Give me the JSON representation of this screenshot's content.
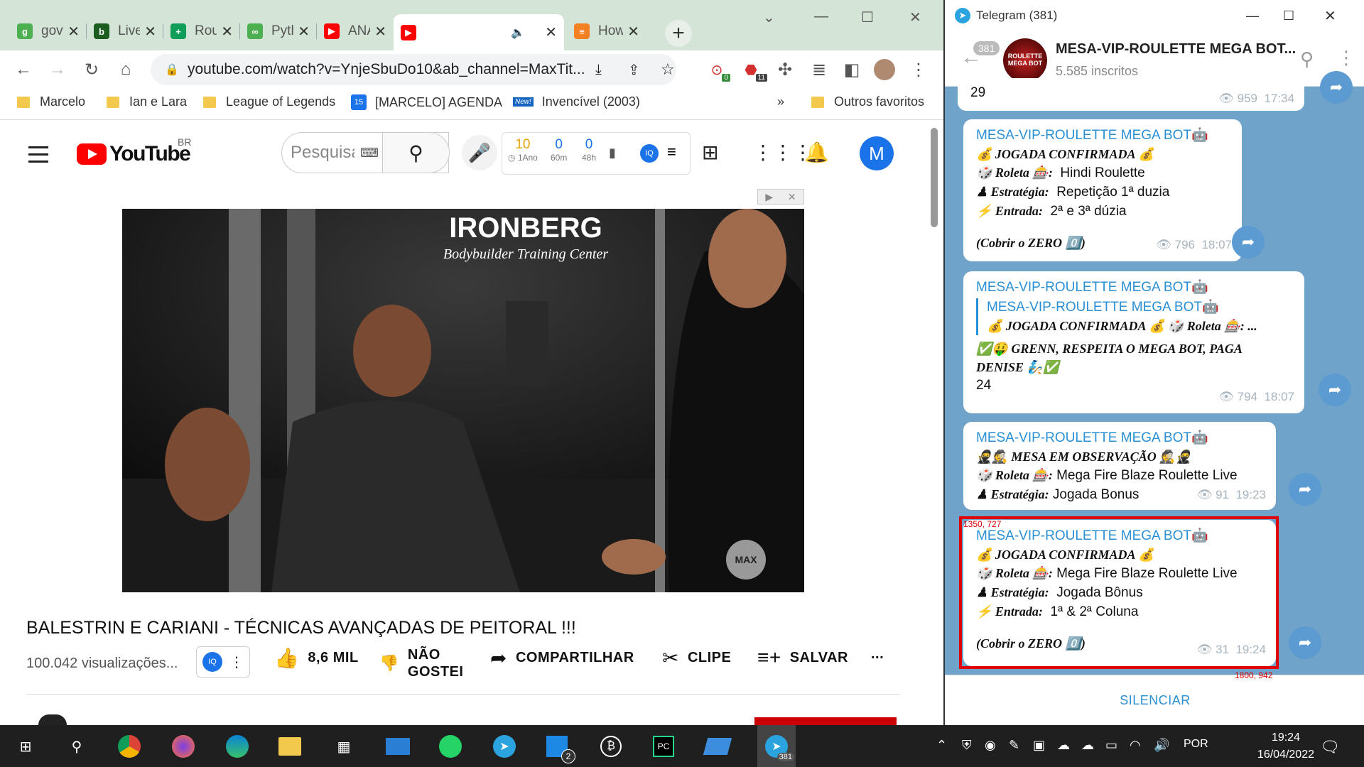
{
  "browser": {
    "tabs": [
      {
        "title": "gov.",
        "fav_color": "#4caf50",
        "fav_text": "g"
      },
      {
        "title": "Live",
        "fav_color": "#1b5e20",
        "fav_text": "b"
      },
      {
        "title": "Roul",
        "fav_color": "#0f9d58",
        "fav_text": "+"
      },
      {
        "title": "Pyth",
        "fav_color": "#4caf50",
        "fav_text": "∞"
      },
      {
        "title": "ANA",
        "fav_color": "#ff0000",
        "fav_text": "▶"
      },
      {
        "title": "",
        "fav_color": "#ff0000",
        "fav_text": "▶"
      },
      {
        "title": "How",
        "fav_color": "#f48024",
        "fav_text": "≡"
      }
    ],
    "url": "youtube.com/watch?v=YnjeSbuDo10&ab_channel=MaxTit...",
    "bookmarks": [
      "Marcelo",
      "Ian e Lara",
      "League of Legends",
      "[MARCELO] AGENDA",
      "Invencível (2003)",
      "Outros favoritos"
    ],
    "bookmark_more": "»",
    "ext_badge_1": "0",
    "ext_badge_2": "11"
  },
  "youtube": {
    "logo": "YouTube",
    "country": "BR",
    "search_placeholder": "Pesquisar",
    "stats": [
      {
        "value": "10",
        "label": "1Ano"
      },
      {
        "value": "0",
        "label": "60m"
      },
      {
        "value": "0",
        "label": "48h"
      }
    ],
    "avatar": "M",
    "video_overlay_brand": "IRONBERG",
    "video_overlay_sub": "Bodybuilder Training Center",
    "video_watermark": "MAX",
    "video_title": "BALESTRIN E CARIANI - TÉCNICAS AVANÇADAS DE PEITORAL !!!",
    "views": "100.042 visualizações...",
    "likes": "8,6 MIL",
    "dislike": "NÃO GOSTEI",
    "share": "COMPARTILHAR",
    "clip": "CLIPE",
    "save": "SALVAR",
    "more": "..."
  },
  "telegram": {
    "window_title": "Telegram (381)",
    "channel_name": "MESA-VIP-ROULETTE MEGA BOT...",
    "subscribers": "5.585 inscritos",
    "unread": "381",
    "logo_text": "ROULETTE MEGA BOT",
    "top_fragment": "29",
    "top_views": "959",
    "top_time": "17:34",
    "messages": [
      {
        "source": "MESA-VIP-ROULETTE MEGA BOT🤖",
        "line1": "💰 JOGADA CONFIRMADA 💰",
        "line2_label": "🎲 Roleta 🎰:",
        "line2_value": "Hindi Roulette",
        "line3_label": "♟ Estratégia:",
        "line3_value": "Repetição 1ª duzia",
        "line4_label": "⚡ Entrada:",
        "line4_value": "2ª e 3ª dúzia",
        "footer": "(Cobrir o ZERO 0️⃣)",
        "views": "796",
        "time": "18:07"
      },
      {
        "source": "MESA-VIP-ROULETTE MEGA BOT🤖",
        "quote_source": "MESA-VIP-ROULETTE MEGA BOT🤖",
        "quote_text": "💰 JOGADA CONFIRMADA 💰 🎲 Roleta 🎰: ...",
        "body": "✅🤑 GRENN, RESPEITA O MEGA BOT, PAGA DENISE 🧞✅",
        "num": "24",
        "views": "794",
        "time": "18:07"
      },
      {
        "source": "MESA-VIP-ROULETTE MEGA BOT🤖",
        "line1": "🥷🕵 MESA EM OBSERVAÇÃO 🕵🥷",
        "line2_label": "🎲 Roleta 🎰:",
        "line2_value": "Mega Fire Blaze Roulette Live",
        "line3_label": "♟ Estratégia:",
        "line3_value": "Jogada Bonus",
        "views": "91",
        "time": "19:23"
      },
      {
        "source": "MESA-VIP-ROULETTE MEGA BOT🤖",
        "line1": "💰 JOGADA CONFIRMADA 💰",
        "line2_label": "🎲 Roleta 🎰:",
        "line2_value": "Mega Fire Blaze Roulette Live",
        "line3_label": "♟ Estratégia:",
        "line3_value": "Jogada Bônus",
        "line4_label": "⚡ Entrada:",
        "line4_value": "1ª & 2ª Coluna",
        "footer": "(Cobrir o ZERO 0️⃣)",
        "views": "31",
        "time": "19:24"
      }
    ],
    "mute": "SILENCIAR"
  },
  "annotation": {
    "label_top": "1350, 727",
    "label_bottom": "1800, 942",
    "color": "#e00000"
  },
  "taskbar": {
    "language": "POR",
    "time": "19:24",
    "date": "16/04/2022",
    "telegram_badge": "381",
    "app_badge": "2"
  }
}
